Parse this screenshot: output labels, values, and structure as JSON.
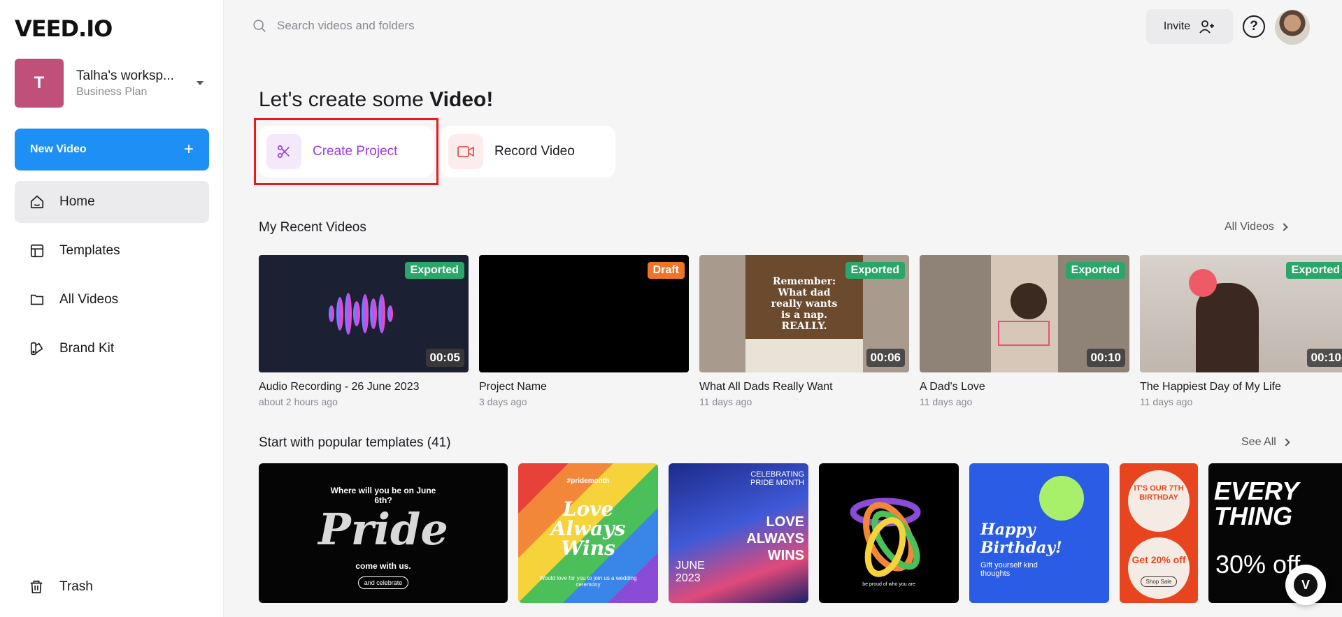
{
  "brand": {
    "logo": "VEED.IO"
  },
  "workspace": {
    "initial": "T",
    "name": "Talha's worksp...",
    "plan": "Business Plan"
  },
  "sidebar": {
    "new_video_label": "New Video",
    "items": [
      {
        "label": "Home",
        "icon": "home-icon",
        "active": true
      },
      {
        "label": "Templates",
        "icon": "templates-icon"
      },
      {
        "label": "All Videos",
        "icon": "folder-icon"
      },
      {
        "label": "Brand Kit",
        "icon": "brand-kit-icon"
      }
    ],
    "trash_label": "Trash"
  },
  "header": {
    "search_placeholder": "Search videos and folders",
    "invite_label": "Invite",
    "help_label": "?"
  },
  "main": {
    "headline_prefix": "Let's create some ",
    "headline_bold": "Video!",
    "actions": {
      "create_project": "Create Project",
      "record_video": "Record Video"
    },
    "recent": {
      "title": "My Recent Videos",
      "link": "All Videos",
      "videos": [
        {
          "title": "Audio Recording - 26 June 2023",
          "time": "about 2 hours ago",
          "status": "Exported",
          "duration": "00:05"
        },
        {
          "title": "Project Name",
          "time": "3 days ago",
          "status": "Draft",
          "duration": ""
        },
        {
          "title": "What All Dads Really Want",
          "time": "11 days ago",
          "status": "Exported",
          "duration": "00:06",
          "overlay": "Remember:\nWhat dad\nreally wants\nis a nap.\nREALLY."
        },
        {
          "title": "A Dad's Love",
          "time": "11 days ago",
          "status": "Exported",
          "duration": "00:10"
        },
        {
          "title": "The Happiest Day of My Life",
          "time": "11 days ago",
          "status": "Exported",
          "duration": "00:10"
        }
      ]
    },
    "templates": {
      "title": "Start with popular templates (41)",
      "link": "See All",
      "items": [
        {
          "top": "Where will you be on June 6th?",
          "main": "Pride",
          "bottom": "come with us.",
          "button": "and celebrate"
        },
        {
          "top": "#pridemonth",
          "main": "Love Always Wins",
          "bottom": "Would love for you to join us a wedding ceremony"
        },
        {
          "top": "CELEBRATING PRIDE MONTH",
          "main": "LOVE ALWAYS WINS",
          "bottom": "JUNE 2023"
        },
        {
          "main": "",
          "bottom": "be proud of who you are"
        },
        {
          "main": "Happy Birthday!",
          "bottom": "Gift yourself kind thoughts"
        },
        {
          "top": "IT'S OUR 7TH BIRTHDAY",
          "main": "Get 20% off",
          "bottom": "Shop Sale"
        },
        {
          "main": "EVERY THING",
          "bottom": "30% off"
        }
      ]
    }
  },
  "colors": {
    "accent": "#1e8ff5",
    "create": "#9b3ce6",
    "exported": "#2aa66a",
    "draft": "#f07427",
    "highlight": "#e61a1a"
  }
}
